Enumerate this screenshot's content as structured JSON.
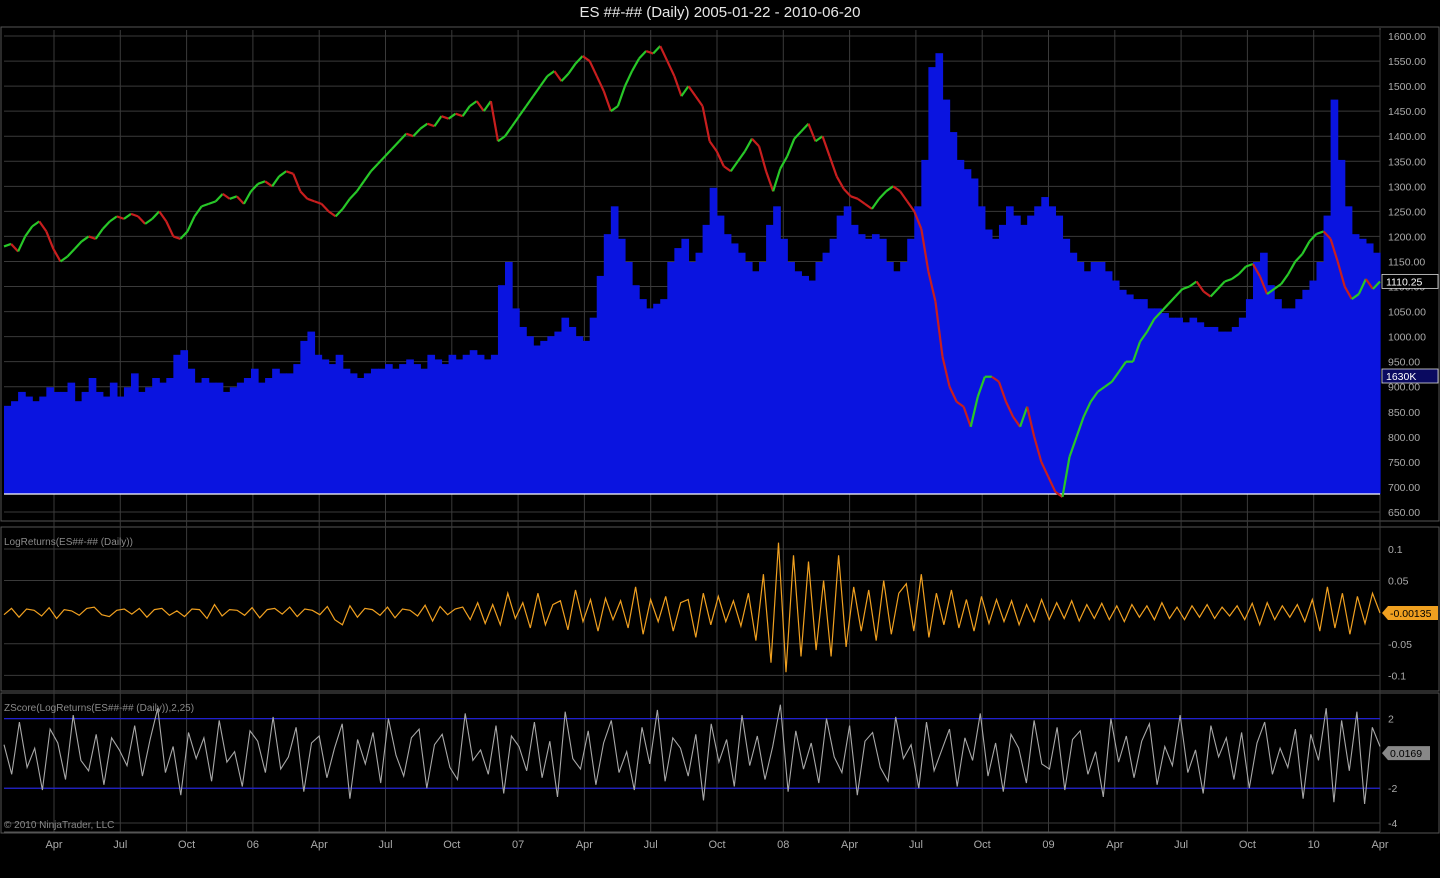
{
  "title": "ES ##-## (Daily)  2005-01-22 - 2010-06-20",
  "copyright": "© 2010 NinjaTrader, LLC",
  "colors": {
    "background": "#000000",
    "grid": "#3a3a3a",
    "volume": "#0a14e0",
    "price_up": "#28c828",
    "price_down": "#c81e1e",
    "log_returns": "#f0a020",
    "zscore": "#a8a8a8",
    "zscore_bands": "#2020d0"
  },
  "chart_data": [
    {
      "type": "line",
      "title": "ES ##-## (Daily)",
      "series": [
        {
          "values": [
            1180,
            1185,
            1170,
            1200,
            1220,
            1230,
            1210,
            1175,
            1150,
            1160,
            1175,
            1190,
            1200,
            1195,
            1215,
            1230,
            1240,
            1235,
            1245,
            1240,
            1225,
            1235,
            1250,
            1230,
            1200,
            1195,
            1210,
            1240,
            1260,
            1265,
            1270,
            1285,
            1275,
            1280,
            1265,
            1290,
            1305,
            1310,
            1300,
            1320,
            1330,
            1325,
            1290,
            1275,
            1270,
            1265,
            1250,
            1240,
            1255,
            1275,
            1290,
            1310,
            1330,
            1345,
            1360,
            1375,
            1390,
            1405,
            1400,
            1415,
            1425,
            1420,
            1440,
            1435,
            1445,
            1440,
            1460,
            1470,
            1450,
            1470,
            1390,
            1400,
            1420,
            1440,
            1460,
            1480,
            1500,
            1520,
            1530,
            1510,
            1525,
            1545,
            1560,
            1550,
            1520,
            1490,
            1450,
            1460,
            1500,
            1530,
            1555,
            1570,
            1565,
            1580,
            1550,
            1520,
            1480,
            1500,
            1480,
            1460,
            1390,
            1370,
            1340,
            1330,
            1350,
            1370,
            1395,
            1380,
            1330,
            1290,
            1335,
            1360,
            1395,
            1410,
            1425,
            1390,
            1400,
            1360,
            1320,
            1295,
            1280,
            1275,
            1265,
            1255,
            1275,
            1290,
            1300,
            1290,
            1270,
            1250,
            1215,
            1130,
            1070,
            960,
            900,
            870,
            860,
            820,
            880,
            920,
            920,
            910,
            870,
            840,
            820,
            860,
            800,
            750,
            720,
            690,
            680,
            760,
            800,
            840,
            870,
            890,
            900,
            910,
            930,
            950,
            950,
            990,
            1010,
            1035,
            1050,
            1065,
            1080,
            1095,
            1100,
            1110,
            1090,
            1080,
            1095,
            1110,
            1115,
            1125,
            1140,
            1145,
            1120,
            1085,
            1095,
            1105,
            1125,
            1150,
            1165,
            1190,
            1205,
            1210,
            1195,
            1150,
            1100,
            1075,
            1085,
            1115,
            1095,
            1110
          ]
        }
      ],
      "x_ticks": [
        "Apr",
        "Jul",
        "Oct",
        "06",
        "Apr",
        "Jul",
        "Oct",
        "07",
        "Apr",
        "Jul",
        "Oct",
        "08",
        "Apr",
        "Jul",
        "Oct",
        "09",
        "Apr",
        "Jul",
        "Oct",
        "10",
        "Apr"
      ],
      "y_ticks": [
        650,
        700,
        750,
        800,
        850,
        900,
        950,
        1000,
        1050,
        1100,
        1150,
        1200,
        1250,
        1300,
        1350,
        1400,
        1450,
        1500,
        1550,
        1600
      ],
      "ylim": [
        638,
        1612
      ],
      "last_value": "1110.25",
      "volume_last": "1630K",
      "volume_values": [
        0.19,
        0.2,
        0.22,
        0.21,
        0.2,
        0.21,
        0.23,
        0.22,
        0.22,
        0.24,
        0.2,
        0.22,
        0.25,
        0.22,
        0.21,
        0.24,
        0.21,
        0.23,
        0.26,
        0.22,
        0.23,
        0.25,
        0.24,
        0.25,
        0.3,
        0.31,
        0.27,
        0.24,
        0.25,
        0.24,
        0.24,
        0.22,
        0.23,
        0.24,
        0.25,
        0.27,
        0.24,
        0.25,
        0.27,
        0.26,
        0.26,
        0.28,
        0.33,
        0.35,
        0.3,
        0.29,
        0.28,
        0.3,
        0.27,
        0.26,
        0.25,
        0.26,
        0.27,
        0.27,
        0.28,
        0.27,
        0.28,
        0.29,
        0.28,
        0.27,
        0.3,
        0.29,
        0.28,
        0.3,
        0.29,
        0.3,
        0.31,
        0.3,
        0.29,
        0.3,
        0.45,
        0.5,
        0.4,
        0.36,
        0.34,
        0.32,
        0.33,
        0.34,
        0.35,
        0.38,
        0.36,
        0.34,
        0.33,
        0.38,
        0.47,
        0.56,
        0.62,
        0.55,
        0.5,
        0.45,
        0.42,
        0.4,
        0.41,
        0.42,
        0.5,
        0.53,
        0.55,
        0.5,
        0.52,
        0.58,
        0.66,
        0.6,
        0.56,
        0.54,
        0.52,
        0.5,
        0.48,
        0.5,
        0.58,
        0.62,
        0.55,
        0.5,
        0.48,
        0.47,
        0.46,
        0.5,
        0.52,
        0.55,
        0.6,
        0.62,
        0.58,
        0.56,
        0.55,
        0.56,
        0.55,
        0.5,
        0.48,
        0.5,
        0.55,
        0.62,
        0.72,
        0.92,
        0.95,
        0.85,
        0.78,
        0.72,
        0.7,
        0.68,
        0.62,
        0.57,
        0.55,
        0.58,
        0.62,
        0.6,
        0.58,
        0.6,
        0.62,
        0.64,
        0.62,
        0.6,
        0.55,
        0.52,
        0.5,
        0.48,
        0.5,
        0.5,
        0.48,
        0.46,
        0.44,
        0.43,
        0.42,
        0.42,
        0.4,
        0.4,
        0.39,
        0.38,
        0.38,
        0.37,
        0.38,
        0.37,
        0.36,
        0.36,
        0.35,
        0.35,
        0.36,
        0.38,
        0.42,
        0.5,
        0.52,
        0.45,
        0.42,
        0.4,
        0.4,
        0.42,
        0.44,
        0.46,
        0.5,
        0.6,
        0.85,
        0.72,
        0.62,
        0.56,
        0.55,
        0.54,
        0.52
      ]
    },
    {
      "type": "line",
      "title": "LogReturns(ES##-## (Daily))",
      "series": [
        {
          "values": [
            -0.004,
            0.006,
            -0.008,
            0.005,
            0.003,
            -0.006,
            0.007,
            -0.01,
            0.004,
            0.002,
            -0.005,
            0.006,
            0.008,
            -0.004,
            -0.007,
            0.003,
            0.005,
            -0.003,
            0.006,
            -0.008,
            0.004,
            0.006,
            -0.005,
            0.002,
            -0.007,
            0.005,
            0.004,
            -0.01,
            0.012,
            -0.006,
            0.004,
            0.003,
            -0.005,
            0.007,
            -0.009,
            0.004,
            0.006,
            -0.003,
            0.008,
            -0.007,
            0.005,
            0.003,
            -0.004,
            0.009,
            -0.012,
            -0.02,
            0.01,
            -0.008,
            0.006,
            0.004,
            -0.005,
            0.008,
            -0.009,
            0.005,
            0.003,
            -0.006,
            0.011,
            -0.014,
            0.009,
            -0.004,
            0.005,
            0.008,
            -0.012,
            0.015,
            -0.018,
            0.012,
            -0.02,
            0.03,
            -0.01,
            0.015,
            -0.025,
            0.03,
            -0.02,
            0.012,
            0.018,
            -0.028,
            0.035,
            -0.015,
            0.02,
            -0.03,
            0.022,
            -0.012,
            0.018,
            -0.025,
            0.04,
            -0.035,
            0.02,
            -0.015,
            0.025,
            -0.03,
            0.015,
            0.02,
            -0.04,
            0.03,
            -0.02,
            0.025,
            -0.015,
            0.018,
            -0.022,
            0.03,
            -0.045,
            0.06,
            -0.08,
            0.11,
            -0.095,
            0.09,
            -0.07,
            0.08,
            -0.06,
            0.05,
            -0.07,
            0.09,
            -0.055,
            0.04,
            -0.03,
            0.035,
            -0.045,
            0.05,
            -0.035,
            0.03,
            0.045,
            -0.03,
            0.06,
            -0.04,
            0.03,
            -0.02,
            0.035,
            -0.025,
            0.02,
            -0.03,
            0.025,
            -0.018,
            0.02,
            -0.015,
            0.018,
            -0.02,
            0.012,
            -0.015,
            0.02,
            -0.012,
            0.015,
            -0.01,
            0.018,
            -0.014,
            0.012,
            -0.01,
            0.014,
            -0.012,
            0.01,
            -0.015,
            0.012,
            -0.008,
            0.01,
            -0.012,
            0.015,
            -0.01,
            0.008,
            -0.012,
            0.01,
            -0.008,
            0.012,
            -0.01,
            0.008,
            -0.006,
            0.01,
            -0.012,
            0.014,
            -0.02,
            0.015,
            -0.012,
            0.01,
            -0.008,
            0.012,
            -0.015,
            0.02,
            -0.03,
            0.04,
            -0.025,
            0.03,
            -0.035,
            0.025,
            -0.018,
            0.03,
            -0.0014
          ]
        }
      ],
      "y_ticks": [
        0.1,
        0.05,
        -0.05,
        -0.1
      ],
      "ylim": [
        -0.12,
        0.13
      ],
      "last_value": "-0.00135"
    },
    {
      "type": "line",
      "title": "ZScore(LogReturns(ES##-## (Daily)),2,25)",
      "series": [
        {
          "values": [
            0.5,
            -1.2,
            1.8,
            -0.8,
            0.3,
            -2.1,
            1.4,
            0.6,
            -1.5,
            2.2,
            -0.4,
            -1.0,
            1.1,
            -1.8,
            0.9,
            0.2,
            -0.7,
            1.6,
            -1.3,
            0.8,
            2.6,
            -1.1,
            0.4,
            -2.4,
            1.2,
            -0.3,
            0.9,
            -1.6,
            1.9,
            -0.5,
            0.1,
            -1.9,
            1.3,
            0.7,
            -1.1,
            2.1,
            -0.9,
            -0.2,
            1.5,
            -2.2,
            0.6,
            1.0,
            -1.4,
            0.3,
            1.7,
            -2.6,
            0.8,
            -0.6,
            1.2,
            -1.7,
            2.0,
            -0.1,
            -1.3,
            0.9,
            1.4,
            -2.0,
            0.5,
            1.1,
            -0.8,
            -1.5,
            2.3,
            -0.4,
            0.2,
            -1.2,
            1.6,
            -2.3,
            1.0,
            0.4,
            -1.0,
            1.8,
            -1.4,
            0.7,
            -2.5,
            2.4,
            -0.3,
            -0.9,
            1.3,
            -1.8,
            0.6,
            1.9,
            -1.1,
            0.1,
            -2.1,
            1.5,
            -0.6,
            2.5,
            -1.6,
            0.9,
            0.3,
            -1.3,
            1.1,
            -2.7,
            1.7,
            -0.5,
            0.8,
            -1.9,
            2.2,
            -0.7,
            1.0,
            -1.5,
            0.4,
            2.8,
            -2.2,
            1.3,
            -0.9,
            0.6,
            -1.7,
            2.0,
            -0.2,
            -1.1,
            1.6,
            -2.4,
            0.7,
            1.2,
            -0.8,
            -1.6,
            2.1,
            -0.3,
            0.5,
            -2.0,
            1.8,
            -1.0,
            0.2,
            1.4,
            -1.9,
            0.9,
            -0.4,
            2.3,
            -1.3,
            0.6,
            -2.2,
            1.1,
            0.3,
            -1.7,
            1.9,
            -0.6,
            -0.9,
            1.5,
            -2.1,
            0.8,
            1.3,
            -1.2,
            0.1,
            -2.5,
            2.0,
            -0.5,
            1.0,
            -1.4,
            0.7,
            1.7,
            -1.8,
            0.4,
            -0.7,
            2.2,
            -1.1,
            0.2,
            -2.3,
            1.6,
            -0.2,
            0.9,
            -1.5,
            1.2,
            -2.0,
            0.6,
            1.8,
            -1.2,
            0.3,
            -0.8,
            1.4,
            -2.6,
            1.1,
            -0.4,
            2.6,
            -2.8,
            1.9,
            -1.0,
            2.4,
            -2.9,
            1.5,
            0.4
          ]
        }
      ],
      "y_ticks": [
        2,
        -2,
        -4
      ],
      "bands": [
        2,
        -2
      ],
      "ylim": [
        -4.4,
        3.3
      ],
      "last_value": "0.0169"
    }
  ]
}
